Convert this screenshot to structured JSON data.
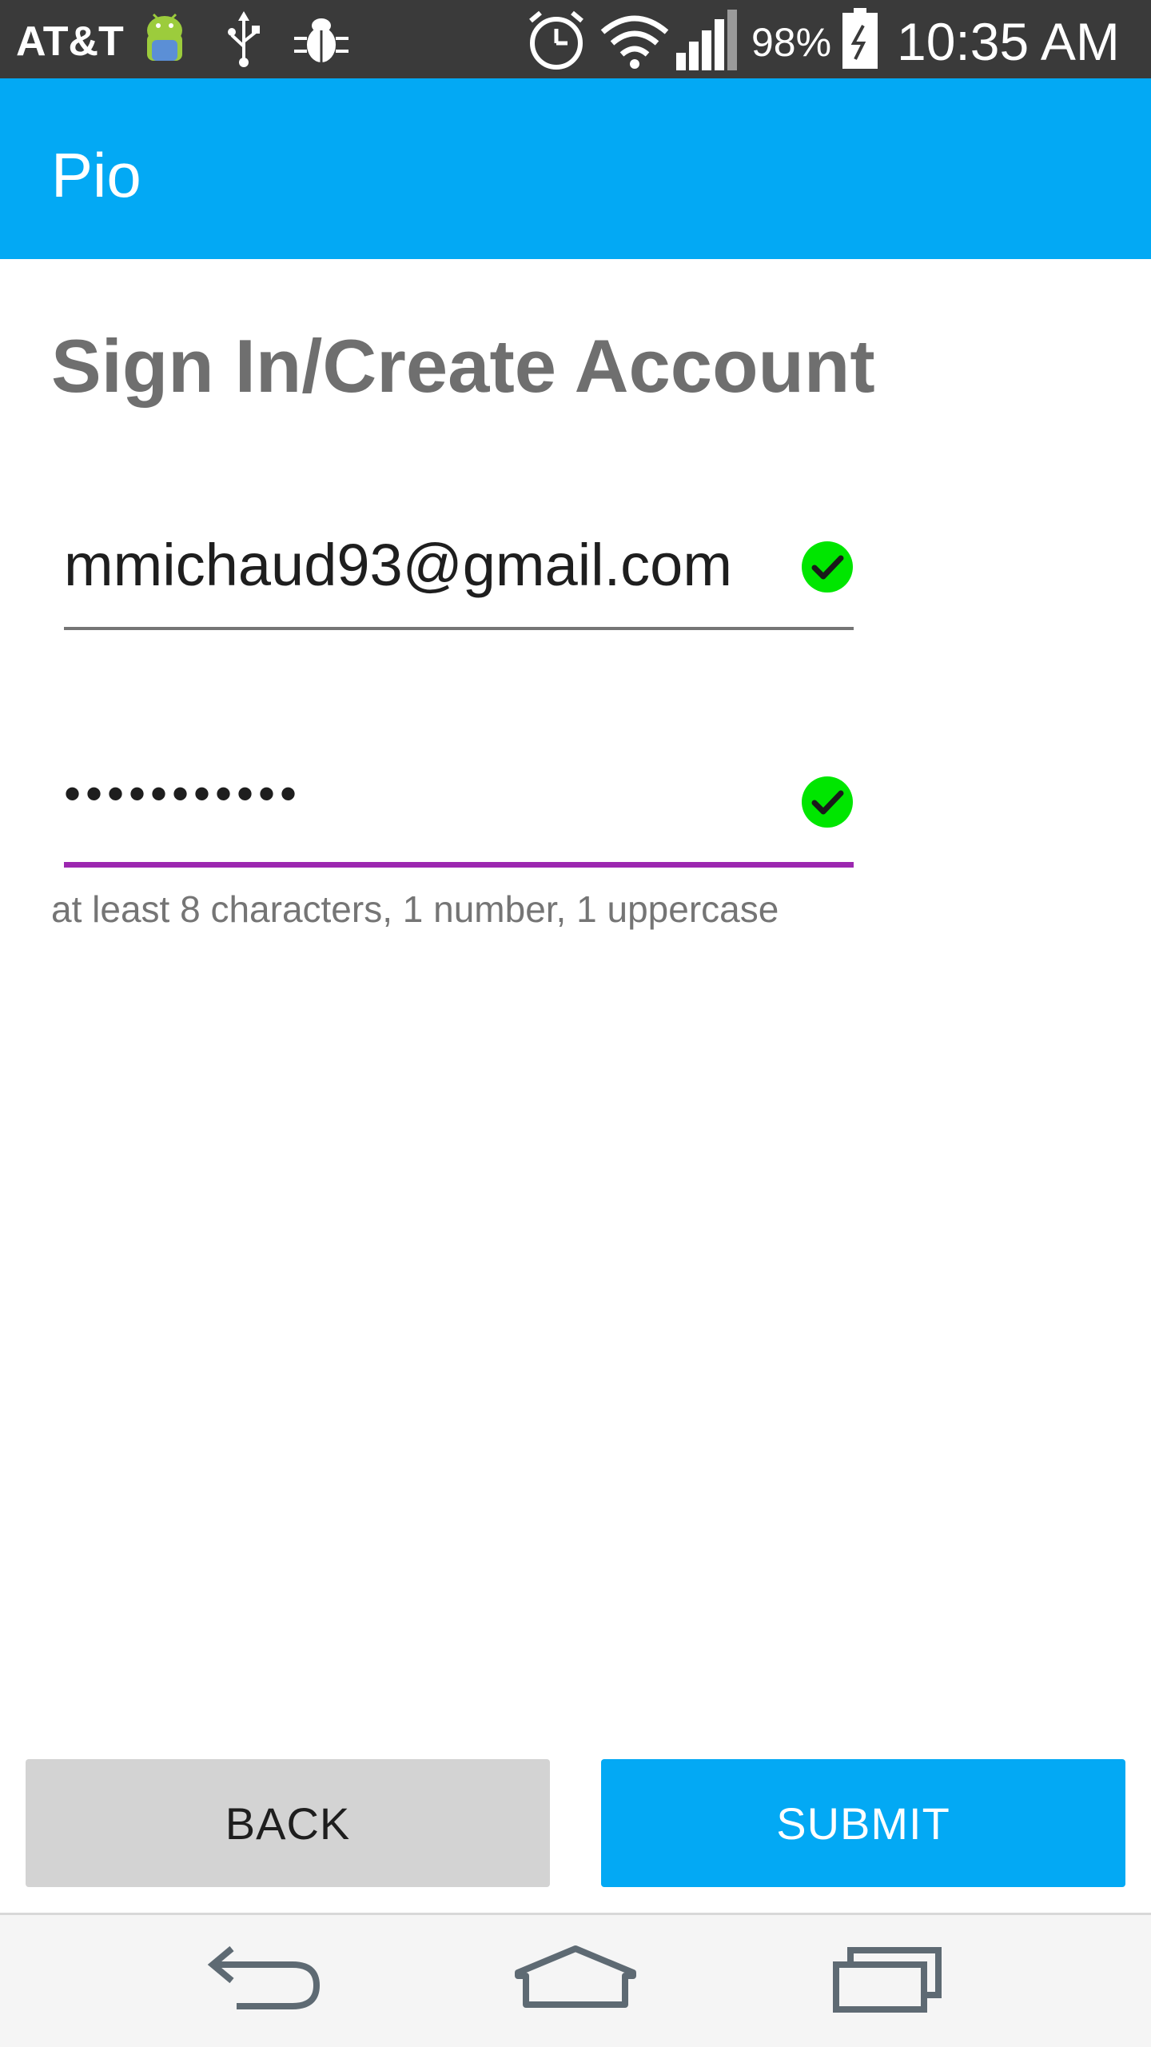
{
  "status_bar": {
    "carrier": "AT&T",
    "battery_percent": "98%",
    "time": "10:35 AM",
    "icons": [
      "android-icon",
      "usb-icon",
      "bug-icon",
      "alarm-icon",
      "wifi-icon",
      "signal-icon",
      "battery-charging-icon"
    ]
  },
  "app_bar": {
    "title": "Pio",
    "color": "#03a9f4"
  },
  "form": {
    "heading": "Sign In/Create Account",
    "email": {
      "value": "mmichaud93@gmail.com",
      "valid": true
    },
    "password": {
      "value": "•••••••••••",
      "valid": true,
      "hint": "at least 8 characters, 1 number, 1 uppercase",
      "focus_color": "#9c27b0"
    }
  },
  "buttons": {
    "back_label": "BACK",
    "submit_label": "SUBMIT"
  },
  "nav_bar": {
    "icons": [
      "back-nav-icon",
      "home-nav-icon",
      "recents-nav-icon"
    ]
  }
}
